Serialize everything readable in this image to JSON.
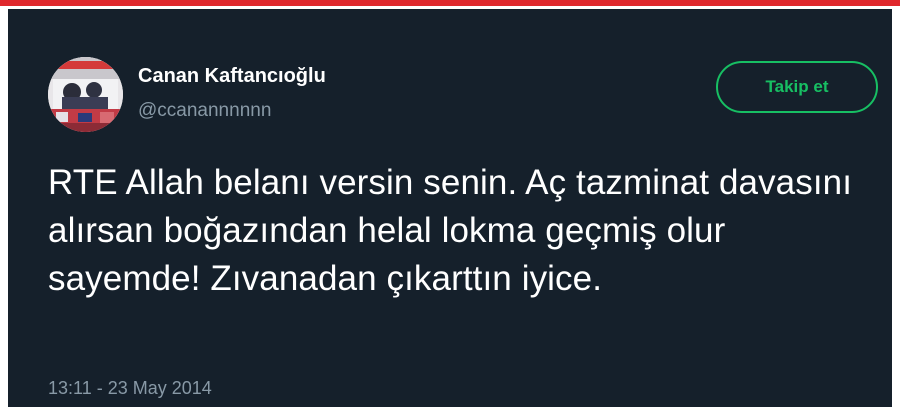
{
  "tweet": {
    "author": {
      "display_name": "Canan Kaftancıoğlu",
      "handle": "@ccanannnnnn",
      "avatar_icon": "profile-photo"
    },
    "follow_button_label": "Takip et",
    "text": "RTE Allah belanı versin senin. Aç tazminat davasını alırsan boğazından helal lokma geçmiş olur sayemde! Zıvanadan çıkarttın iyice.",
    "timestamp": "13:11 - 23 May 2014"
  },
  "colors": {
    "top_bar": "#e0282d",
    "card_background": "#15202b",
    "text_primary": "#ffffff",
    "text_secondary": "#8899a6",
    "accent_green": "#17bf63"
  }
}
